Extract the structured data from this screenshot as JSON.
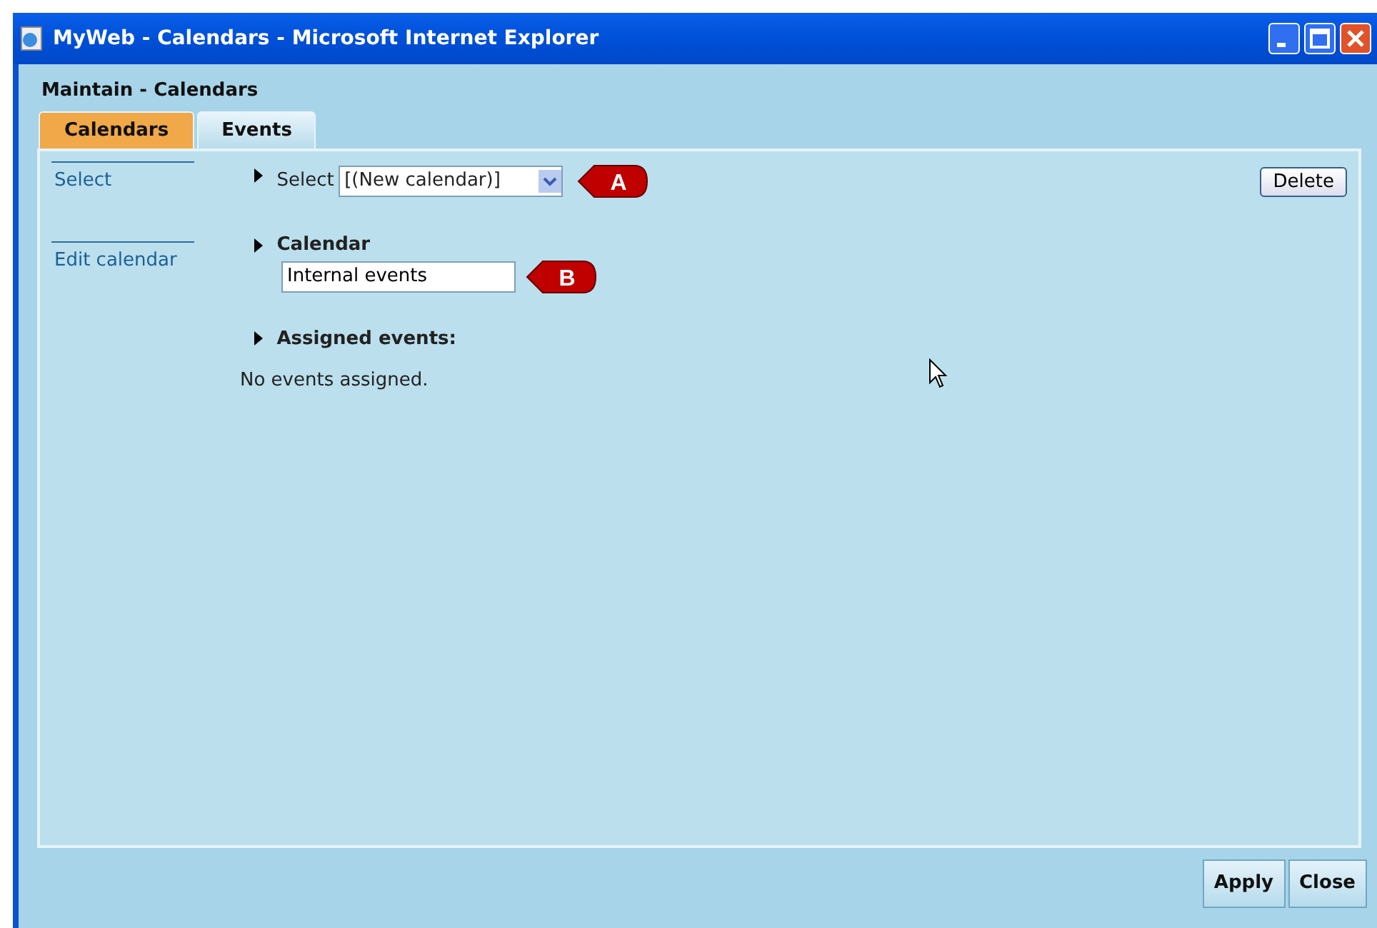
{
  "window": {
    "title": "MyWeb - Calendars - Microsoft Internet Explorer"
  },
  "page_title": "Maintain - Calendars",
  "tabs": [
    {
      "label": "Calendars",
      "selected": true
    },
    {
      "label": "Events",
      "selected": false
    }
  ],
  "sidebar": {
    "items": [
      {
        "label": "Select"
      },
      {
        "label": "Edit calendar"
      }
    ]
  },
  "select_section": {
    "label": "Select",
    "value": "[(New calendar)]",
    "callout": "A"
  },
  "delete_button": "Delete",
  "calendar_section": {
    "heading": "Calendar",
    "value": "Internal events",
    "callout": "B"
  },
  "events_section": {
    "heading": "Assigned events:",
    "empty_text": "No events assigned."
  },
  "buttons": [
    "Apply",
    "Close"
  ]
}
